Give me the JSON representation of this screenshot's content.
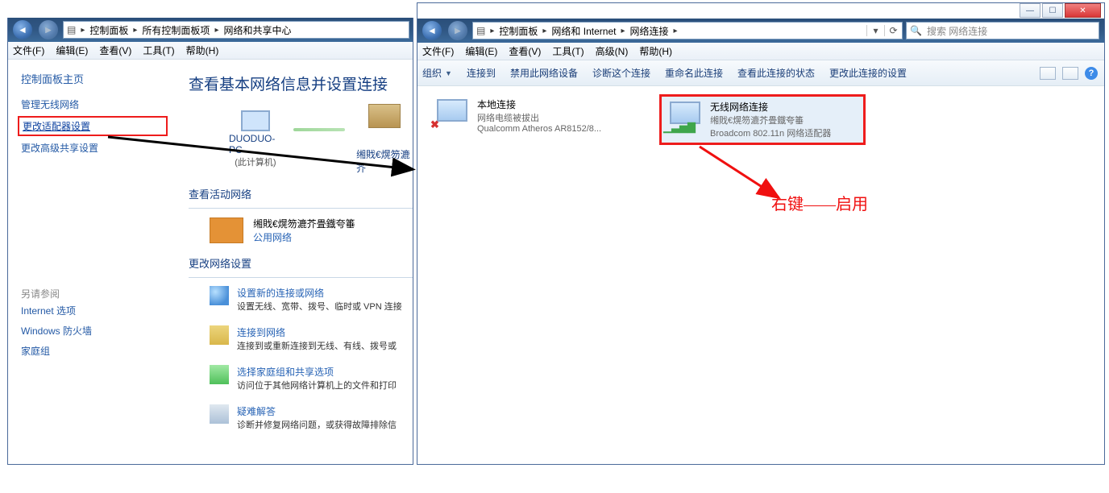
{
  "left_window": {
    "breadcrumb": [
      "控制面板",
      "所有控制面板项",
      "网络和共享中心"
    ],
    "menu": [
      "文件(F)",
      "编辑(E)",
      "查看(V)",
      "工具(T)",
      "帮助(H)"
    ],
    "sidebar": {
      "heading": "控制面板主页",
      "links": [
        "管理无线网络",
        "更改适配器设置",
        "更改高级共享设置"
      ],
      "see_also_label": "另请参阅",
      "see_also": [
        "Internet 选项",
        "Windows 防火墙",
        "家庭组"
      ]
    },
    "main_title": "查看基本网络信息并设置连接",
    "pc_name": "DUODUO-PC",
    "pc_sub": "(此计算机)",
    "inet_name": "缃戝€熀笏漉芥",
    "section_active": "查看活动网络",
    "active_name": "缃戝€熀笏漉芥畳鐡夸箠",
    "active_type": "公用网络",
    "section_change": "更改网络设置",
    "opts": [
      {
        "title": "设置新的连接或网络",
        "desc": "设置无线、宽带、拨号、临时或 VPN 连接"
      },
      {
        "title": "连接到网络",
        "desc": "连接到或重新连接到无线、有线、拨号或"
      },
      {
        "title": "选择家庭组和共享选项",
        "desc": "访问位于其他网络计算机上的文件和打印"
      },
      {
        "title": "疑难解答",
        "desc": "诊断并修复网络问题，或获得故障排除信"
      }
    ]
  },
  "right_window": {
    "breadcrumb": [
      "控制面板",
      "网络和 Internet",
      "网络连接"
    ],
    "search_placeholder": "搜索 网络连接",
    "menu": [
      "文件(F)",
      "编辑(E)",
      "查看(V)",
      "工具(T)",
      "高级(N)",
      "帮助(H)"
    ],
    "cmdbar": [
      "组织",
      "连接到",
      "禁用此网络设备",
      "诊断这个连接",
      "重命名此连接",
      "查看此连接的状态",
      "更改此连接的设置"
    ],
    "devices": [
      {
        "name": "本地连接",
        "status": "网络电缆被拔出",
        "adapter": "Qualcomm Atheros AR8152/8...",
        "disabled": true
      },
      {
        "name": "无线网络连接",
        "status": "缃戝€熀笏漉芥畳鐡夸箠",
        "adapter": "Broadcom 802.11n 网络适配器",
        "disabled": false
      }
    ]
  },
  "annotation_text": "右键——启用"
}
